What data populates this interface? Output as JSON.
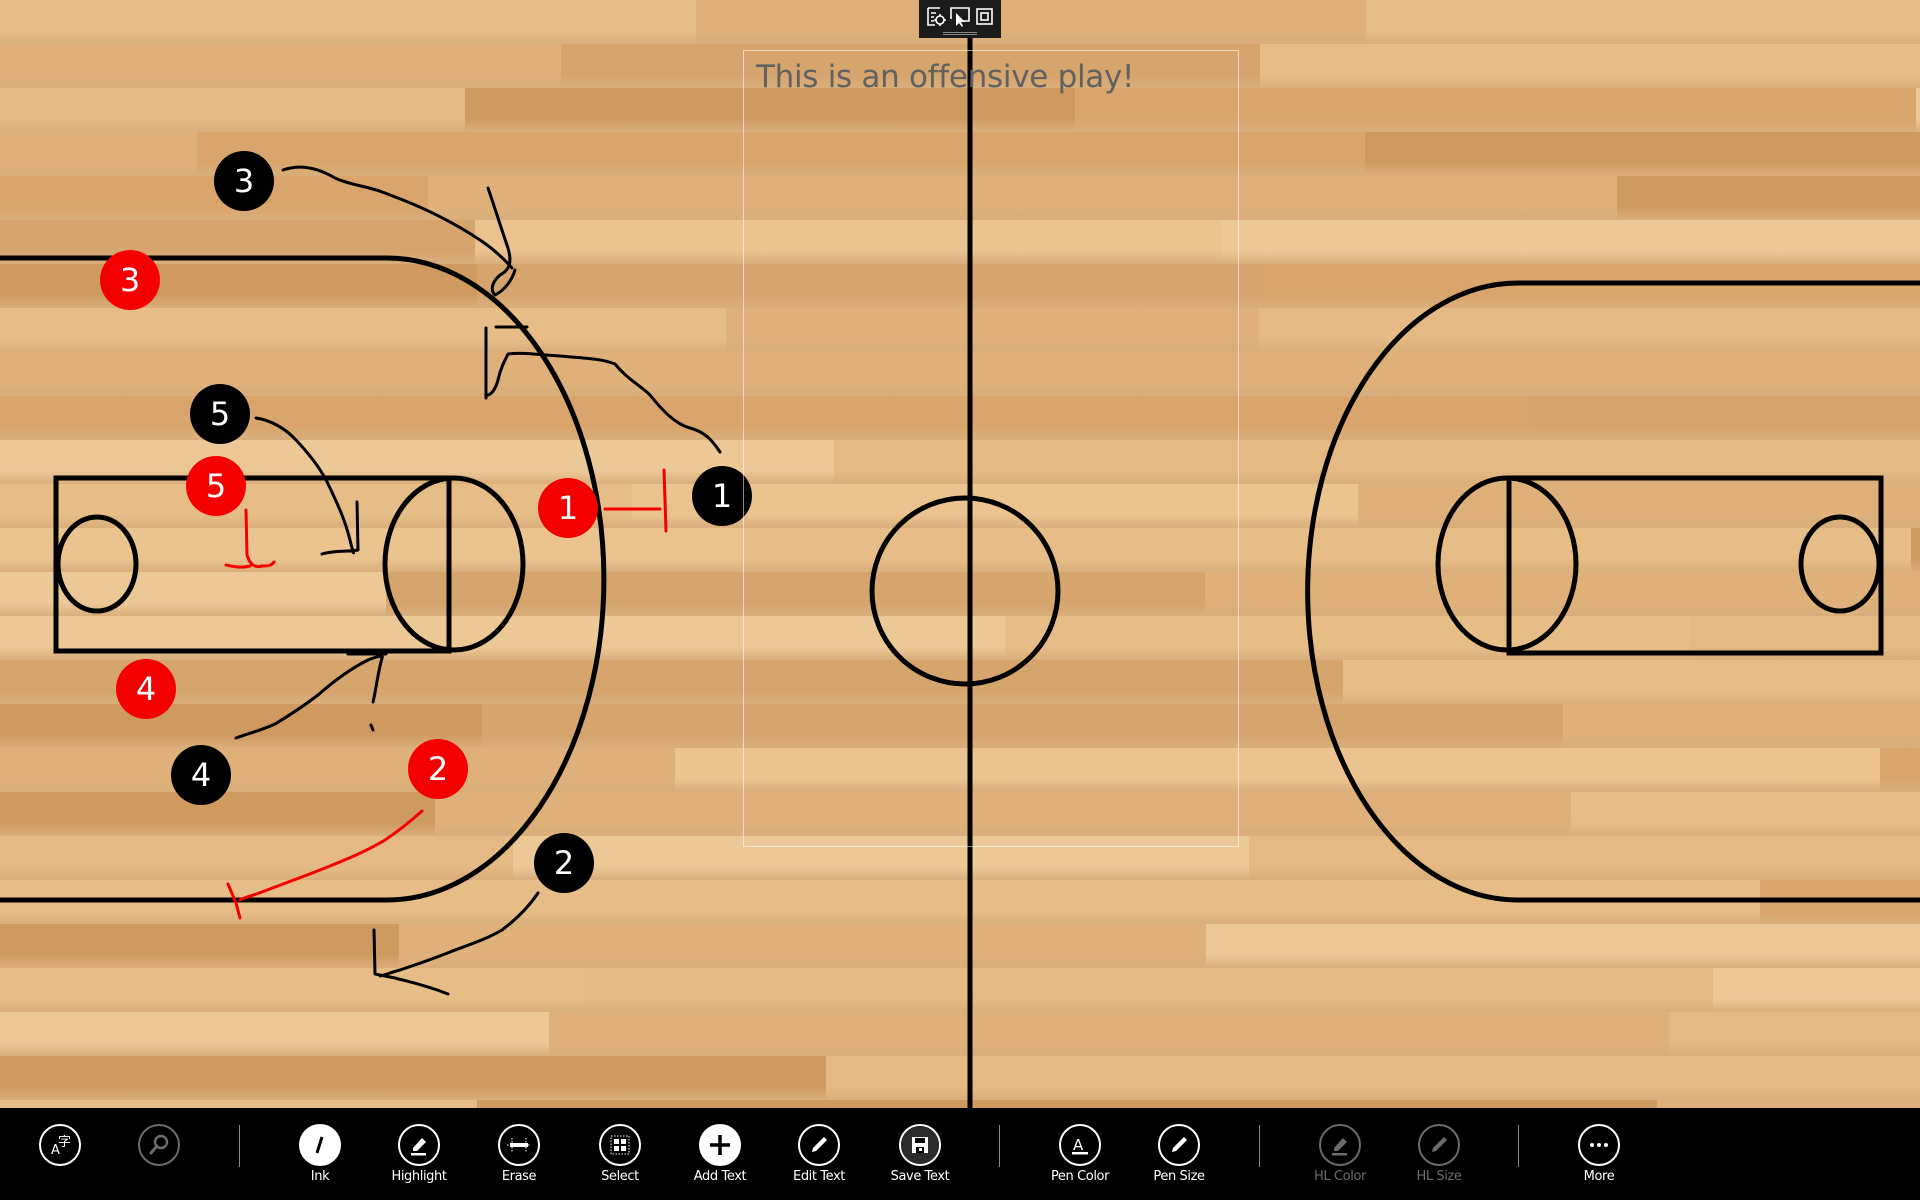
{
  "app": {
    "name": "Basketball play whiteboard",
    "colors": {
      "offense_player": "#000000",
      "defense_player": "#f40000",
      "ink_black": "#000000",
      "ink_red": "#f40000",
      "court_lines": "#000000",
      "appbar_bg": "#000000",
      "disabled": "#6b6b6b"
    }
  },
  "top_handle": {
    "icons": [
      "text-settings-icon",
      "select-pointer-icon",
      "fullscreen-icon"
    ]
  },
  "textbox": {
    "text": "This is an offensive play!"
  },
  "players": {
    "offense": [
      {
        "number": "1"
      },
      {
        "number": "2"
      },
      {
        "number": "3"
      },
      {
        "number": "4"
      },
      {
        "number": "5"
      }
    ],
    "defense": [
      {
        "number": "1"
      },
      {
        "number": "2"
      },
      {
        "number": "3"
      },
      {
        "number": "4"
      },
      {
        "number": "5"
      }
    ]
  },
  "appbar": {
    "buttons": [
      {
        "id": "language",
        "label": "",
        "icon": "language-icon",
        "state": "normal"
      },
      {
        "id": "zoom",
        "label": "",
        "icon": "search-icon",
        "state": "disabled"
      },
      {
        "id": "ink",
        "label": "Ink",
        "icon": "pen-icon",
        "state": "active"
      },
      {
        "id": "highlight",
        "label": "Highlight",
        "icon": "highlighter-icon",
        "state": "normal"
      },
      {
        "id": "erase",
        "label": "Erase",
        "icon": "eraser-icon",
        "state": "normal"
      },
      {
        "id": "select",
        "label": "Select",
        "icon": "select-icon",
        "state": "normal"
      },
      {
        "id": "add-text",
        "label": "Add Text",
        "icon": "plus-icon",
        "state": "active"
      },
      {
        "id": "edit-text",
        "label": "Edit Text",
        "icon": "pencil-icon",
        "state": "normal"
      },
      {
        "id": "save-text",
        "label": "Save Text",
        "icon": "save-icon",
        "state": "normal"
      },
      {
        "id": "pen-color",
        "label": "Pen Color",
        "icon": "font-color-icon",
        "state": "normal"
      },
      {
        "id": "pen-size",
        "label": "Pen Size",
        "icon": "pencil-icon",
        "state": "normal"
      },
      {
        "id": "hl-color",
        "label": "HL Color",
        "icon": "highlighter-icon",
        "state": "disabled"
      },
      {
        "id": "hl-size",
        "label": "HL Size",
        "icon": "pencil-icon",
        "state": "disabled"
      },
      {
        "id": "more",
        "label": "More",
        "icon": "more-icon",
        "state": "normal"
      }
    ]
  }
}
